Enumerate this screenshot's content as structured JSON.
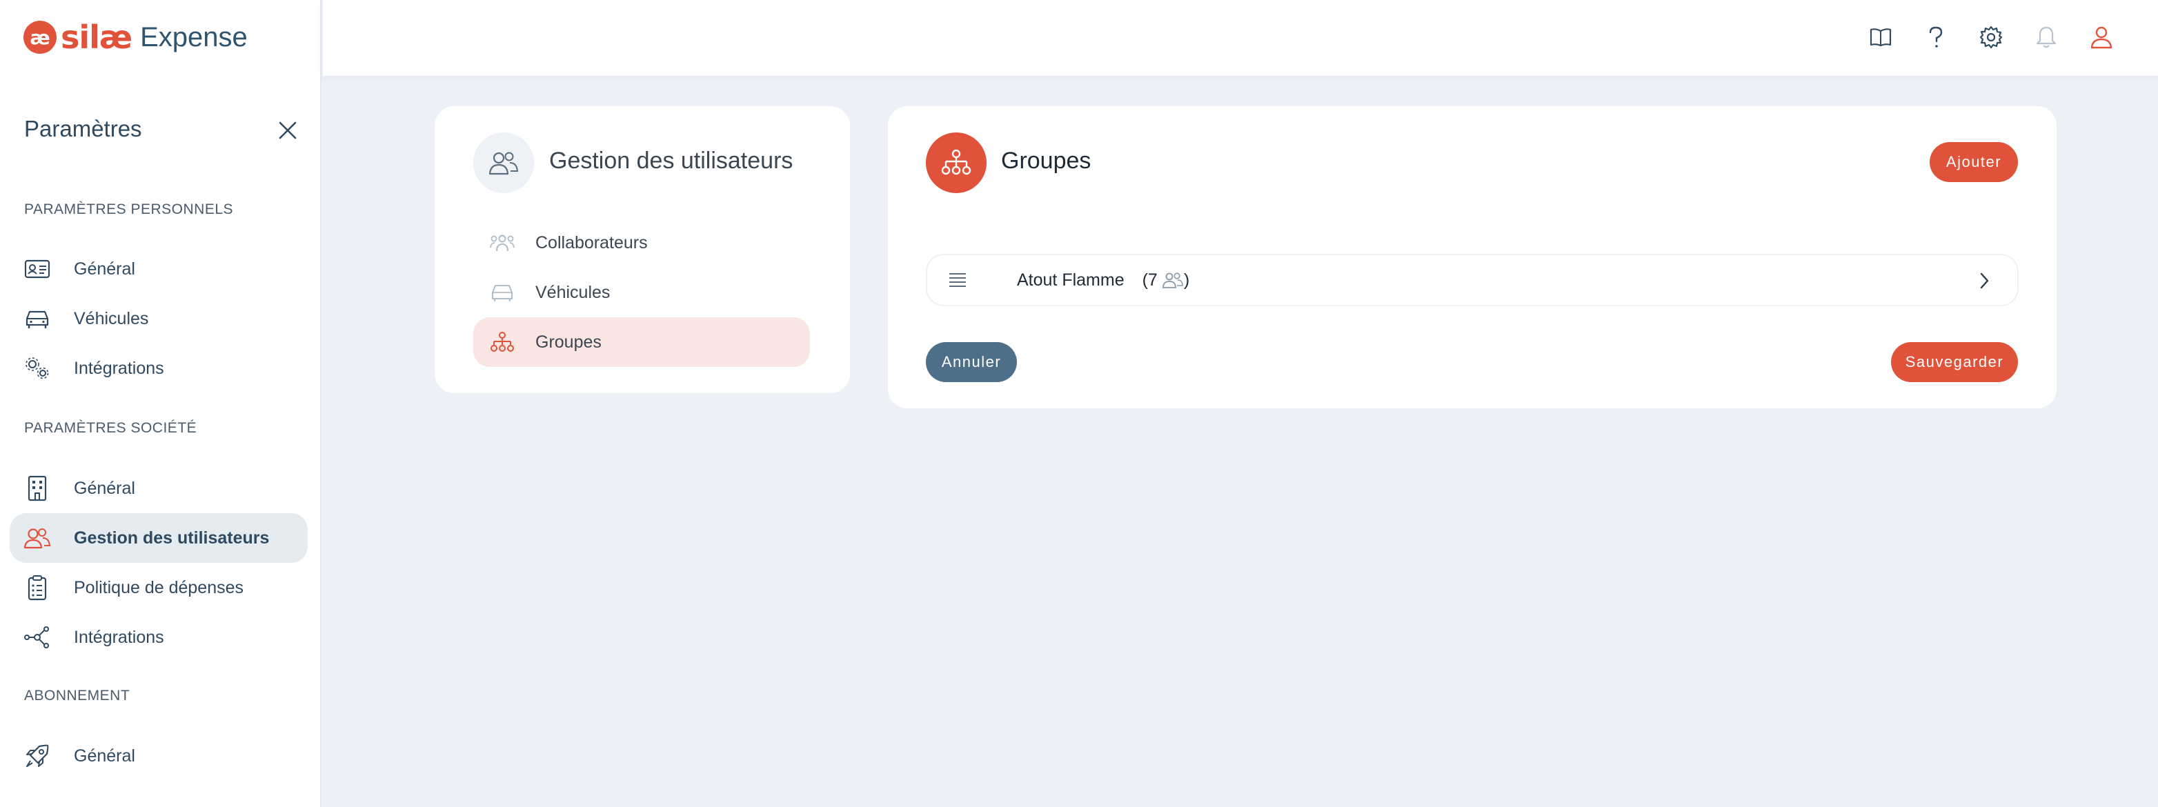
{
  "app": {
    "logo_mark": "æ",
    "brand": "silæ",
    "product": "Expense"
  },
  "sidebar": {
    "title": "Paramètres",
    "sections": [
      {
        "title": "PARAMÈTRES PERSONNELS",
        "items": [
          {
            "label": "Général",
            "icon": "id-card-icon"
          },
          {
            "label": "Véhicules",
            "icon": "car-icon"
          },
          {
            "label": "Intégrations",
            "icon": "gears-icon"
          }
        ]
      },
      {
        "title": "PARAMÈTRES SOCIÉTÉ",
        "items": [
          {
            "label": "Général",
            "icon": "building-icon"
          },
          {
            "label": "Gestion des utilisateurs",
            "icon": "users-icon",
            "active": true
          },
          {
            "label": "Politique de dépenses",
            "icon": "clipboard-icon"
          },
          {
            "label": "Intégrations",
            "icon": "network-icon"
          }
        ]
      },
      {
        "title": "ABONNEMENT",
        "items": [
          {
            "label": "Général",
            "icon": "rocket-icon"
          }
        ]
      }
    ]
  },
  "topbar": {
    "icons": [
      "book-icon",
      "help-icon",
      "gear-icon",
      "bell-icon",
      "user-icon"
    ]
  },
  "user_management": {
    "title": "Gestion des utilisateurs",
    "items": [
      {
        "label": "Collaborateurs",
        "icon": "people-icon"
      },
      {
        "label": "Véhicules",
        "icon": "car-icon"
      },
      {
        "label": "Groupes",
        "icon": "hierarchy-icon",
        "active": true
      }
    ]
  },
  "groups": {
    "title": "Groupes",
    "add_label": "Ajouter",
    "rows": [
      {
        "name": "Atout Flamme",
        "count_open": "(7",
        "count_close": ")",
        "members": 7
      }
    ],
    "cancel_label": "Annuler",
    "save_label": "Sauvegarder"
  },
  "colors": {
    "accent": "#e0533a",
    "secondary": "#4e6f88",
    "background": "#edf0f7",
    "active_sidebar": "#e6ebef",
    "active_item": "#f9e5e1"
  }
}
